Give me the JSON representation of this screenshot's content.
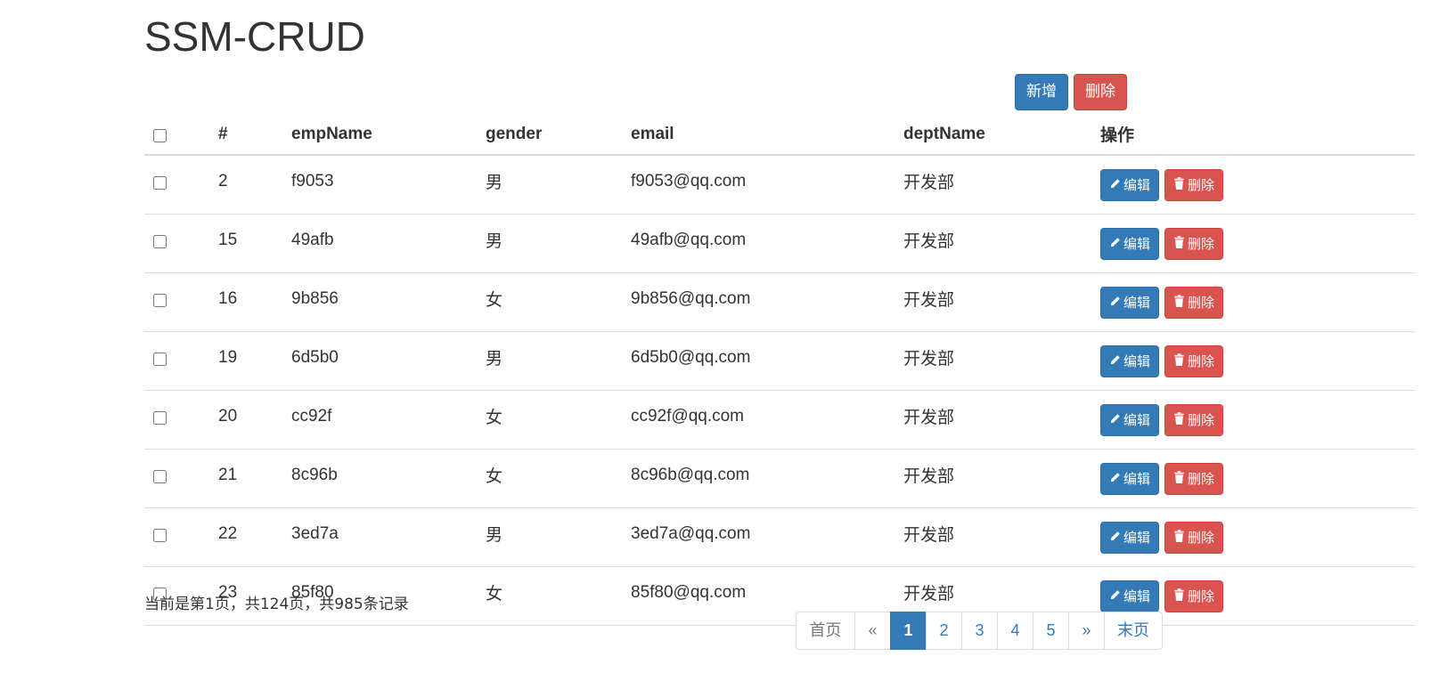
{
  "app": {
    "title": "SSM-CRUD"
  },
  "toolbar": {
    "add_label": "新增",
    "delete_label": "删除"
  },
  "table": {
    "headers": [
      "#",
      "empName",
      "gender",
      "email",
      "deptName",
      "操作"
    ],
    "rows": [
      {
        "id": "2",
        "name": "f9053",
        "gender": "男",
        "email": "f9053@qq.com",
        "dept": "开发部"
      },
      {
        "id": "15",
        "name": "49afb",
        "gender": "男",
        "email": "49afb@qq.com",
        "dept": "开发部"
      },
      {
        "id": "16",
        "name": "9b856",
        "gender": "女",
        "email": "9b856@qq.com",
        "dept": "开发部"
      },
      {
        "id": "19",
        "name": "6d5b0",
        "gender": "男",
        "email": "6d5b0@qq.com",
        "dept": "开发部"
      },
      {
        "id": "20",
        "name": "cc92f",
        "gender": "女",
        "email": "cc92f@qq.com",
        "dept": "开发部"
      },
      {
        "id": "21",
        "name": "8c96b",
        "gender": "女",
        "email": "8c96b@qq.com",
        "dept": "开发部"
      },
      {
        "id": "22",
        "name": "3ed7a",
        "gender": "男",
        "email": "3ed7a@qq.com",
        "dept": "开发部"
      },
      {
        "id": "23",
        "name": "85f80",
        "gender": "女",
        "email": "85f80@qq.com",
        "dept": "开发部"
      }
    ],
    "row_actions": {
      "edit_label": "编辑",
      "delete_label": "删除",
      "edit_icon": "pencil-icon",
      "delete_icon": "trash-icon"
    }
  },
  "page_info": "当前是第1页，共124页，共985条记录",
  "pagination": {
    "first": "首页",
    "prev": "«",
    "pages": [
      "1",
      "2",
      "3",
      "4",
      "5"
    ],
    "active": "1",
    "next": "»",
    "last": "末页"
  },
  "colors": {
    "primary": "#337ab7",
    "danger": "#d9534f",
    "text": "#333333",
    "border": "#dddddd"
  }
}
